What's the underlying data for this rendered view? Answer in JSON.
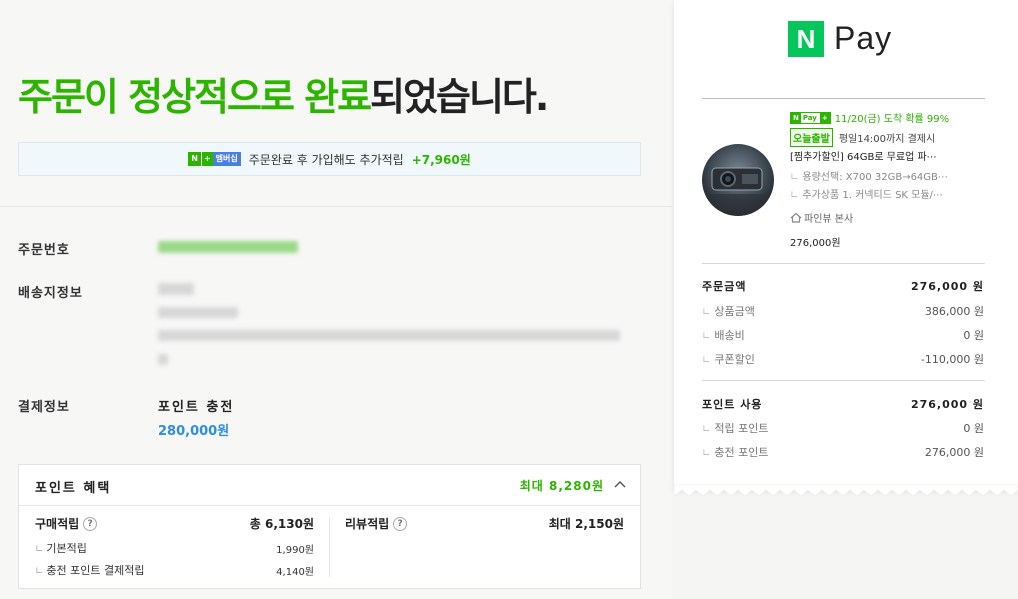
{
  "headline": {
    "part_green": "주문이 정상적으로 완료",
    "part_dark": "되었습니다."
  },
  "membership_banner": {
    "badge_n": "N",
    "badge_plus": "+",
    "badge_member": "멤버십",
    "text": "주문완료 후 가입해도 추가적립",
    "amount": "+7,960원"
  },
  "order_info": {
    "order_number_label": "주문번호",
    "shipping_label": "배송지정보",
    "payment_label": "결제정보",
    "payment_method": "포인트 충전",
    "payment_amount": "280,000원"
  },
  "benefits": {
    "title": "포인트 혜택",
    "max_label": "최대 8,280원",
    "purchase_title": "구매적립",
    "purchase_total": "총 6,130원",
    "purchase_items": [
      {
        "label": "기본적립",
        "value": "1,990원"
      },
      {
        "label": "충전 포인트 결제적립",
        "value": "4,140원"
      }
    ],
    "review_title": "리뷰적립",
    "review_total": "최대 2,150원",
    "help_glyph": "?"
  },
  "receipt": {
    "logo_n": "N",
    "logo_pay": "Pay",
    "delivery_badge_n": "N",
    "delivery_badge_pay": "Pay",
    "delivery_badge_plus": "+",
    "delivery_text": "11/20(금) 도착 확률 99%",
    "today_badge": "오늘출발",
    "today_text": "평일14:00까지 결제시",
    "product_name": "[찜추가할인] 64GB로 무료업 파⋯",
    "product_options": [
      "용량선택: X700 32GB→64GB⋯",
      "추가상품 1. 커넥티드 SK 모듈/⋯"
    ],
    "seller": "파인뷰 본사",
    "product_price": "276,000원",
    "order_amount_label": "주문금액",
    "order_amount": "276,000 원",
    "order_breakdown": [
      {
        "label": "상품금액",
        "value": "386,000 원"
      },
      {
        "label": "배송비",
        "value": "0 원"
      },
      {
        "label": "쿠폰할인",
        "value": "-110,000 원"
      }
    ],
    "point_use_label": "포인트 사용",
    "point_use_amount": "276,000 원",
    "point_breakdown": [
      {
        "label": "적립 포인트",
        "value": "0 원"
      },
      {
        "label": "충전 포인트",
        "value": "276,000 원"
      }
    ]
  },
  "colors": {
    "brand_green": "#2db400",
    "npay_green": "#03c75a",
    "amount_blue": "#2e8ee0"
  }
}
